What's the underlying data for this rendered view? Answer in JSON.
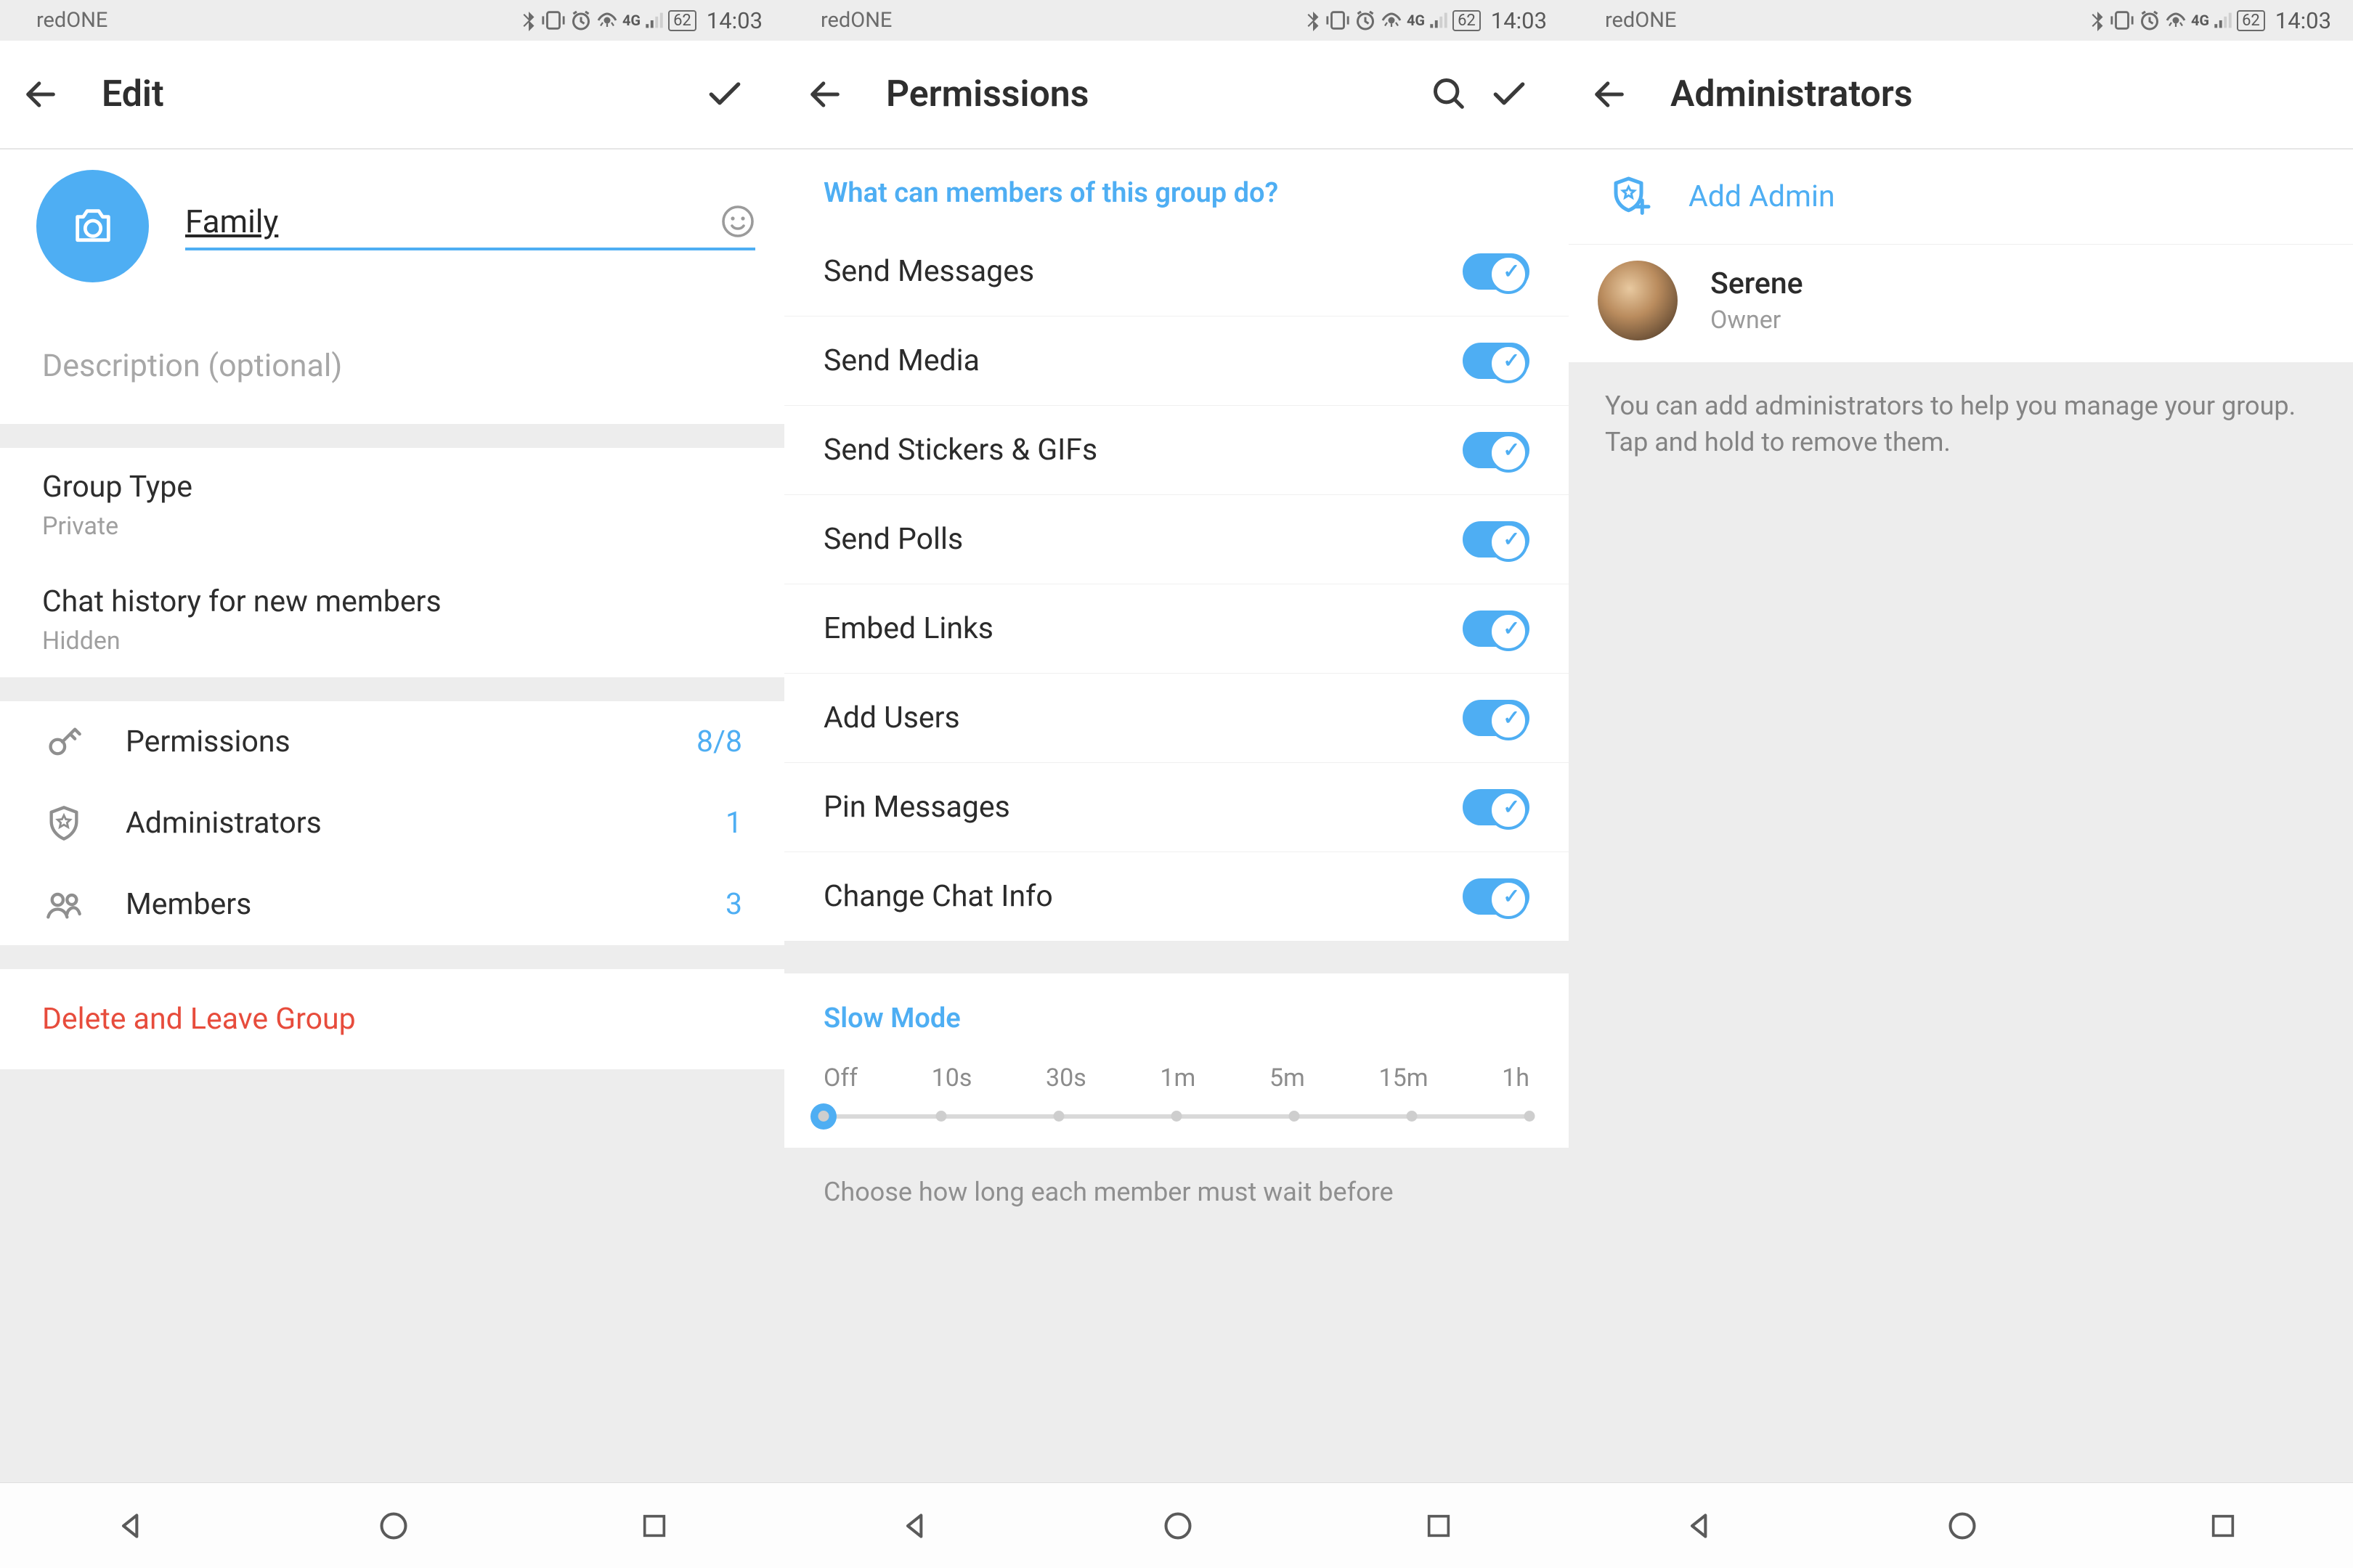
{
  "statusbar": {
    "carrier": "redONE",
    "time": "14:03",
    "battery": "62"
  },
  "panel1": {
    "header_title": "Edit",
    "group_name": "Family",
    "description_placeholder": "Description (optional)",
    "group_type_label": "Group Type",
    "group_type_value": "Private",
    "history_label": "Chat history for new members",
    "history_value": "Hidden",
    "permissions_label": "Permissions",
    "permissions_value": "8/8",
    "admins_label": "Administrators",
    "admins_value": "1",
    "members_label": "Members",
    "members_value": "3",
    "delete_label": "Delete and Leave Group"
  },
  "panel2": {
    "header_title": "Permissions",
    "section_header": "What can members of this group do?",
    "permissions": [
      {
        "label": "Send Messages",
        "on": true
      },
      {
        "label": "Send Media",
        "on": true
      },
      {
        "label": "Send Stickers & GIFs",
        "on": true
      },
      {
        "label": "Send Polls",
        "on": true
      },
      {
        "label": "Embed Links",
        "on": true
      },
      {
        "label": "Add Users",
        "on": true
      },
      {
        "label": "Pin Messages",
        "on": true
      },
      {
        "label": "Change Chat Info",
        "on": true
      }
    ],
    "slowmode_header": "Slow Mode",
    "slowmode_ticks": [
      "Off",
      "10s",
      "30s",
      "1m",
      "5m",
      "15m",
      "1h"
    ],
    "slowmode_value": "Off",
    "slowmode_footer": "Choose how long each member must wait before"
  },
  "panel3": {
    "header_title": "Administrators",
    "add_admin_label": "Add Admin",
    "admins": [
      {
        "name": "Serene",
        "role": "Owner"
      }
    ],
    "infobox": "You can add administrators to help you manage your group. Tap and hold to remove them."
  }
}
